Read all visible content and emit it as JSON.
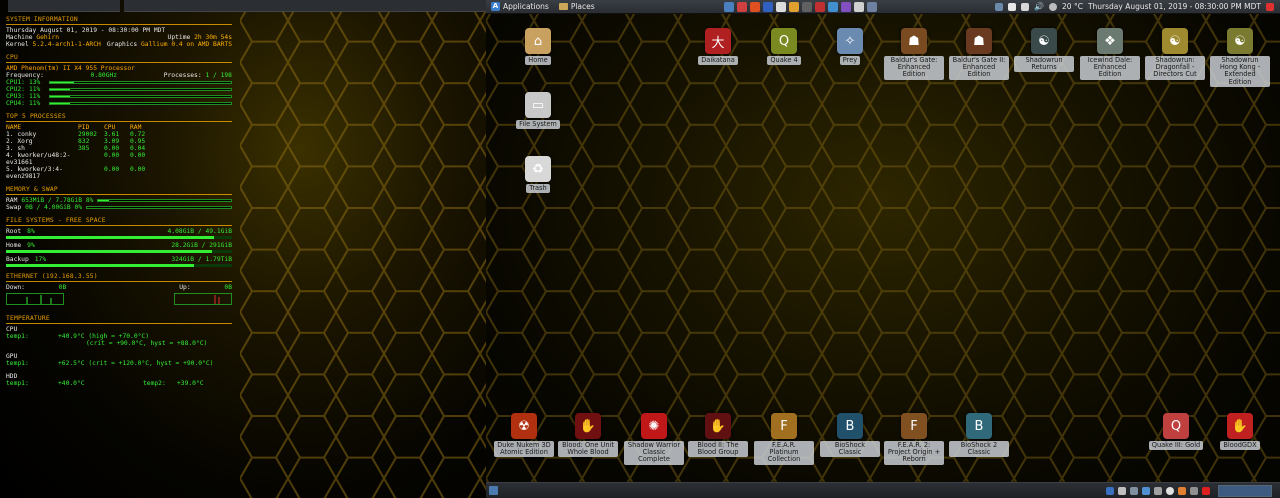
{
  "conky": {
    "system_header": "SYSTEM INFORMATION",
    "datetime": "Thursday August 01, 2019 - 08:30:00 PM MDT",
    "machine_label": "Machine",
    "machine_value": "Gehirn",
    "uptime_label": "Uptime",
    "uptime_value": "2h 30m 54s",
    "kernel_label": "Kernel",
    "kernel_value": "5.2.4-arch1-1-ARCH",
    "graphics_label": "Graphics",
    "graphics_value": "Gallium 0.4 on AMD BARTS",
    "cpu_header": "CPU",
    "cpu_name": "AMD Phenom(tm) II X4 955 Processor",
    "freq_label": "Frequency:",
    "freq_value": "0.80GHz",
    "procs_label": "Processes:",
    "procs_value": "1 / 198",
    "cores": [
      {
        "label": "CPU1:",
        "pct": "13%",
        "level": 0.13
      },
      {
        "label": "CPU2:",
        "pct": "11%",
        "level": 0.11
      },
      {
        "label": "CPU3:",
        "pct": "11%",
        "level": 0.11
      },
      {
        "label": "CPU4:",
        "pct": "11%",
        "level": 0.11
      }
    ],
    "top_header": "TOP 5 PROCESSES",
    "proc_headers": [
      "NAME",
      "PID",
      "CPU",
      "RAM"
    ],
    "processes": [
      [
        "1. conky",
        "29002",
        "3.61",
        "0.72"
      ],
      [
        "2. Xorg",
        "832",
        "3.09",
        "0.95"
      ],
      [
        "3. sh",
        "385",
        "0.00",
        "0.04"
      ],
      [
        "4. kworker/u48:2-ev31661",
        "",
        "0.00",
        "0.00"
      ],
      [
        "5. kworker/3:4-even29817",
        "",
        "0.00",
        "0.00"
      ]
    ],
    "mem_header": "MEMORY & SWAP",
    "ram_label": "RAM",
    "ram_value": "653MiB / 7.78GiB 8%",
    "ram_level": 0.08,
    "swap_label": "Swap",
    "swap_value": "0B / 4.00GiB 0%",
    "swap_level": 0.0,
    "fs_header": "FILE SYSTEMS - FREE SPACE",
    "filesystems": [
      {
        "label": "Root",
        "pct": "8%",
        "value": "4.08GiB / 49.1GiB",
        "level": 0.92
      },
      {
        "label": "Home",
        "pct": "9%",
        "value": "28.2GiB / 291GiB",
        "level": 0.91
      },
      {
        "label": "Backup",
        "pct": "17%",
        "value": "324GiB / 1.79TiB",
        "level": 0.83
      }
    ],
    "eth_header": "ETHERNET (192.168.3.55)",
    "down_label": "Down:",
    "down_value": "0B",
    "up_label": "Up:",
    "up_value": "0B",
    "temp_header": "TEMPERATURE",
    "cpu_temp_title": "CPU",
    "cpu_temp_line1_label": "temp1:",
    "cpu_temp_line1": "+40.9°C  (high = +70.0°C)",
    "cpu_temp_line2": "(crit = +90.0°C, hyst = +88.0°C)",
    "gpu_temp_title": "GPU",
    "gpu_temp_label": "temp1:",
    "gpu_temp_line": "+62.5°C  (crit = +120.0°C, hyst = +90.0°C)",
    "hdd_temp_title": "HDD",
    "hdd_temp1_label": "temp1:",
    "hdd_temp1_value": "+40.0°C",
    "hdd_temp2_label": "temp2:",
    "hdd_temp2_value": "+39.0°C"
  },
  "top_panel": {
    "applications": "Applications",
    "places": "Places",
    "temperature": "20 °C",
    "clock": "Thursday August 01, 2019 - 08:30:00 PM MDT",
    "launcher_colors": [
      "#4a7fc0",
      "#d04040",
      "#e05020",
      "#3060c0",
      "#dddddd",
      "#e0a030",
      "#606060",
      "#c03030",
      "#4090d0",
      "#8050c0",
      "#d0d0d0",
      "#7080a0"
    ]
  },
  "desktop": {
    "icons": [
      {
        "name": "Home",
        "color": "#c8a060",
        "glyph": "⌂"
      },
      {
        "name": "File System",
        "color": "#c8c8c8",
        "glyph": "▭"
      },
      {
        "name": "Trash",
        "color": "#d8d8d8",
        "glyph": "♻"
      },
      {
        "name": "Daikatana",
        "color": "#b02020",
        "glyph": "大"
      },
      {
        "name": "Quake 4",
        "color": "#7a8a20",
        "glyph": "Q"
      },
      {
        "name": "Prey",
        "color": "#6a8ab0",
        "glyph": "✧"
      },
      {
        "name": "Baldur's Gate: Enhanced Edition",
        "color": "#7a4a20",
        "glyph": "☗"
      },
      {
        "name": "Baldur's Gate II: Enhanced Edition",
        "color": "#6a3a20",
        "glyph": "☗"
      },
      {
        "name": "Shadowrun Returns",
        "color": "#3a4a4a",
        "glyph": "☯"
      },
      {
        "name": "Icewind Dale: Enhanced Edition",
        "color": "#6a7a70",
        "glyph": "❖"
      },
      {
        "name": "Shadowrun: Dragonfall - Directors Cut",
        "color": "#a08a30",
        "glyph": "☯"
      },
      {
        "name": "Shadowrun Hong Kong - Extended Edition",
        "color": "#7a7a30",
        "glyph": "☯"
      },
      {
        "name": "Duke Nukem 3D Atomic Edition",
        "color": "#b03010",
        "glyph": "☢"
      },
      {
        "name": "Blood: One Unit Whole Blood",
        "color": "#701010",
        "glyph": "✋"
      },
      {
        "name": "Shadow Warrior Classic Complete",
        "color": "#c01818",
        "glyph": "✺"
      },
      {
        "name": "Blood II: The Blood Group",
        "color": "#601010",
        "glyph": "✋"
      },
      {
        "name": "F.E.A.R. Platinum Collection",
        "color": "#a07020",
        "glyph": "F"
      },
      {
        "name": "BioShock Classic",
        "color": "#20506a",
        "glyph": "B"
      },
      {
        "name": "F.E.A.R. 2: Project Origin + Reborn",
        "color": "#805020",
        "glyph": "F"
      },
      {
        "name": "BioShock 2 Classic",
        "color": "#306a7a",
        "glyph": "B"
      },
      {
        "name": "Quake III: Gold",
        "color": "#c04040",
        "glyph": "Q"
      },
      {
        "name": "BloodGDX",
        "color": "#c02020",
        "glyph": "✋"
      }
    ]
  }
}
